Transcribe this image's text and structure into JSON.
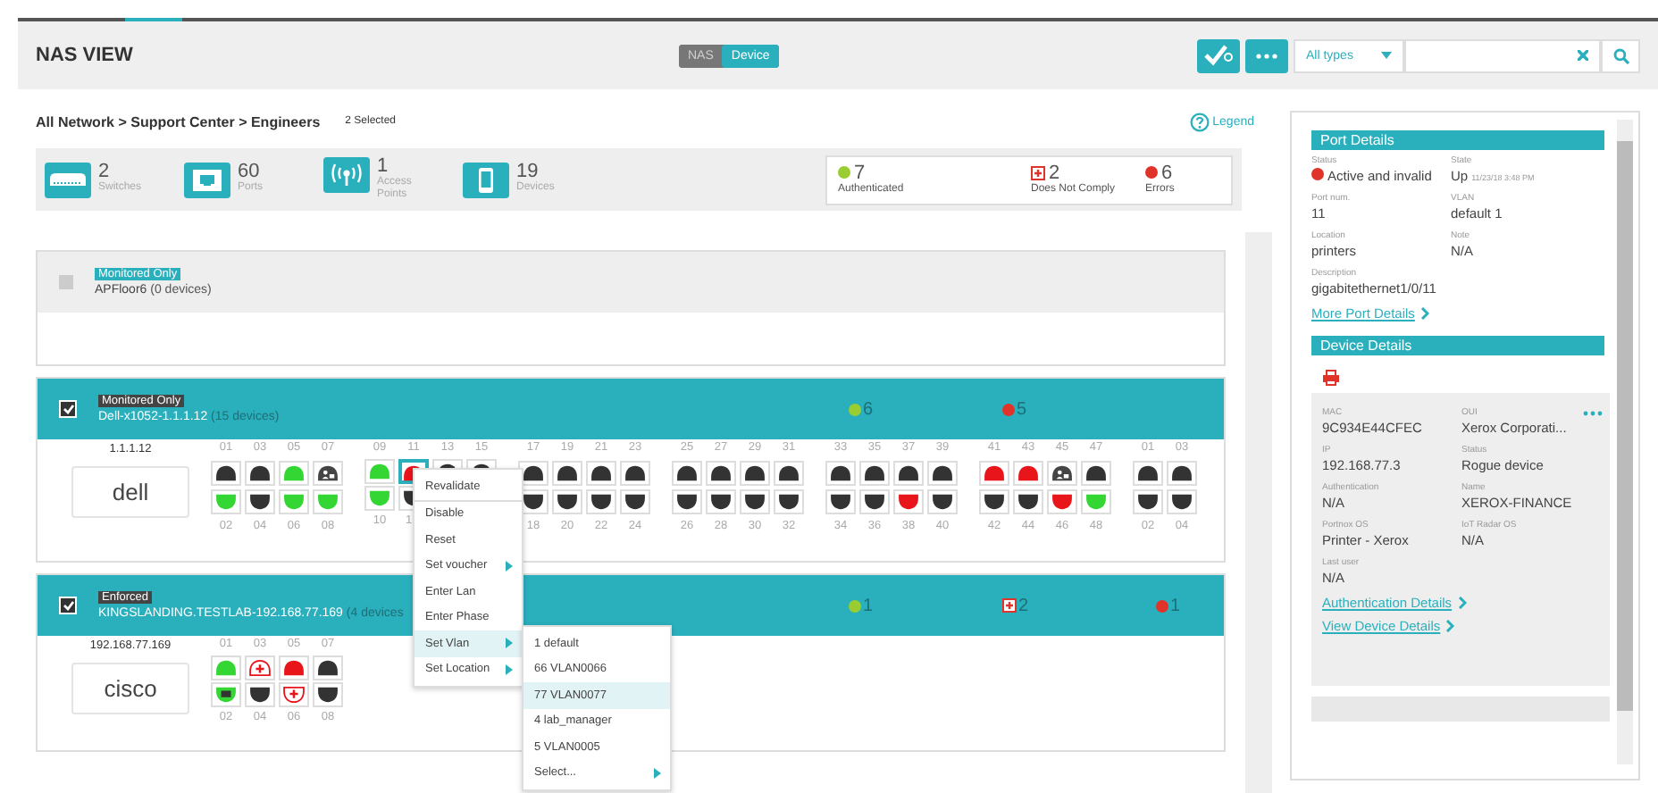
{
  "header": {
    "title": "NAS VIEW",
    "view_toggle": [
      {
        "label": "NAS",
        "selected": false
      },
      {
        "label": "Device",
        "selected": true
      }
    ],
    "type_filter": "All types"
  },
  "breadcrumb": "All Network > Support Center > Engineers",
  "selection_count": "2 Selected",
  "legend": "Legend",
  "stats": [
    {
      "kind": "switch",
      "value": "2",
      "label": "Switches"
    },
    {
      "kind": "port",
      "value": "60",
      "label": "Ports"
    },
    {
      "kind": "wifi",
      "value": "1",
      "label": "Access Points"
    },
    {
      "kind": "phone",
      "value": "19",
      "label": "Devices"
    }
  ],
  "summary": [
    {
      "kind": "authenticated",
      "value": "7",
      "label": "Authenticated"
    },
    {
      "kind": "noncompliant",
      "value": "2",
      "label": "Does Not Comply"
    },
    {
      "kind": "error",
      "value": "6",
      "label": "Errors"
    }
  ],
  "switches": [
    {
      "badge": "Monitored Only",
      "name": "APFloor6",
      "device_count": "(0 devices)",
      "checked": false,
      "selected": false
    },
    {
      "badge": "Monitored Only",
      "name": "Dell-x1052-1.1.1.12",
      "device_count": "(15 devices)",
      "checked": true,
      "selected": true,
      "ip": "1.1.1.12",
      "logo": "dell",
      "counts": [
        {
          "kind": "authenticated",
          "value": "6"
        },
        {
          "kind": "error",
          "value": "5"
        }
      ],
      "port_groups": [
        {
          "top": [
            {
              "number": "01",
              "kind": "black",
              "selected": false
            },
            {
              "number": "03",
              "kind": "black",
              "selected": false
            },
            {
              "number": "05",
              "kind": "green",
              "selected": false
            },
            {
              "number": "07",
              "kind": "user",
              "selected": false
            }
          ],
          "bottom": [
            {
              "number": "02",
              "kind": "green",
              "selected": false
            },
            {
              "number": "04",
              "kind": "black",
              "selected": false
            },
            {
              "number": "06",
              "kind": "green",
              "selected": false
            },
            {
              "number": "08",
              "kind": "green",
              "selected": false
            }
          ]
        },
        {
          "top": [
            {
              "number": "09",
              "kind": "green",
              "selected": false
            },
            {
              "number": "11",
              "kind": "red",
              "selected": true
            },
            {
              "number": "13",
              "kind": "black",
              "selected": false
            },
            {
              "number": "15",
              "kind": "black",
              "selected": false
            }
          ],
          "bottom": [
            {
              "number": "10",
              "kind": "green",
              "selected": false
            },
            {
              "number": "1",
              "kind": "black",
              "selected": false
            }
          ]
        },
        {
          "top": [
            {
              "number": "17",
              "kind": "black",
              "selected": false
            },
            {
              "number": "19",
              "kind": "black",
              "selected": false
            },
            {
              "number": "21",
              "kind": "black",
              "selected": false
            },
            {
              "number": "23",
              "kind": "black",
              "selected": false
            }
          ],
          "bottom": [
            {
              "number": "18",
              "kind": "black",
              "selected": false
            },
            {
              "number": "20",
              "kind": "black",
              "selected": false
            },
            {
              "number": "22",
              "kind": "black",
              "selected": false
            },
            {
              "number": "24",
              "kind": "black",
              "selected": false
            }
          ]
        },
        {
          "top": [
            {
              "number": "25",
              "kind": "black",
              "selected": false
            },
            {
              "number": "27",
              "kind": "black",
              "selected": false
            },
            {
              "number": "29",
              "kind": "black",
              "selected": false
            },
            {
              "number": "31",
              "kind": "black",
              "selected": false
            }
          ],
          "bottom": [
            {
              "number": "26",
              "kind": "black",
              "selected": false
            },
            {
              "number": "28",
              "kind": "black",
              "selected": false
            },
            {
              "number": "30",
              "kind": "black",
              "selected": false
            },
            {
              "number": "32",
              "kind": "black",
              "selected": false
            }
          ]
        },
        {
          "top": [
            {
              "number": "33",
              "kind": "black",
              "selected": false
            },
            {
              "number": "35",
              "kind": "black",
              "selected": false
            },
            {
              "number": "37",
              "kind": "black",
              "selected": false
            },
            {
              "number": "39",
              "kind": "black",
              "selected": false
            }
          ],
          "bottom": [
            {
              "number": "34",
              "kind": "black",
              "selected": false
            },
            {
              "number": "36",
              "kind": "black",
              "selected": false
            },
            {
              "number": "38",
              "kind": "red",
              "selected": false
            },
            {
              "number": "40",
              "kind": "black",
              "selected": false
            }
          ]
        },
        {
          "top": [
            {
              "number": "41",
              "kind": "red",
              "selected": false
            },
            {
              "number": "43",
              "kind": "red",
              "selected": false
            },
            {
              "number": "45",
              "kind": "user",
              "selected": false
            },
            {
              "number": "47",
              "kind": "black",
              "selected": false
            }
          ],
          "bottom": [
            {
              "number": "42",
              "kind": "black",
              "selected": false
            },
            {
              "number": "44",
              "kind": "black",
              "selected": false
            },
            {
              "number": "46",
              "kind": "red",
              "selected": false
            },
            {
              "number": "48",
              "kind": "green",
              "selected": false
            }
          ]
        },
        {
          "top": [
            {
              "number": "01",
              "kind": "black",
              "selected": false
            },
            {
              "number": "03",
              "kind": "black",
              "selected": false
            }
          ],
          "bottom": [
            {
              "number": "02",
              "kind": "black",
              "selected": false
            },
            {
              "number": "04",
              "kind": "black",
              "selected": false
            }
          ]
        }
      ]
    },
    {
      "badge": "Enforced",
      "name": "KINGSLANDING.TESTLAB-192.168.77.169",
      "device_count": "(4 devices",
      "checked": true,
      "selected": true,
      "ip": "192.168.77.169",
      "logo": "cisco",
      "counts": [
        {
          "kind": "authenticated",
          "value": "1"
        },
        {
          "kind": "noncompliant",
          "value": "2"
        },
        {
          "kind": "error",
          "value": "1"
        }
      ],
      "port_groups": [
        {
          "top": [
            {
              "number": "01",
              "kind": "green",
              "selected": false
            },
            {
              "number": "03",
              "kind": "plus",
              "selected": false
            },
            {
              "number": "05",
              "kind": "red",
              "selected": false
            },
            {
              "number": "07",
              "kind": "black",
              "selected": false
            }
          ],
          "bottom": [
            {
              "number": "02",
              "kind": "green-user",
              "selected": false
            },
            {
              "number": "04",
              "kind": "black",
              "selected": false
            },
            {
              "number": "06",
              "kind": "plus",
              "selected": false
            },
            {
              "number": "08",
              "kind": "black",
              "selected": false
            }
          ]
        }
      ]
    }
  ],
  "context_menu": {
    "items": [
      {
        "label": "Revalidate",
        "submenu": false,
        "selected": false
      },
      {
        "label": "Disable",
        "submenu": false,
        "selected": false
      },
      {
        "label": "Reset",
        "submenu": false,
        "selected": false
      },
      {
        "label": "Set voucher",
        "submenu": true,
        "selected": false
      },
      {
        "label": "Enter Lan",
        "submenu": false,
        "selected": false
      },
      {
        "label": "Enter Phase",
        "submenu": false,
        "selected": false
      },
      {
        "label": "Set Vlan",
        "submenu": true,
        "selected": true
      },
      {
        "label": "Set Location",
        "submenu": true,
        "selected": false
      }
    ],
    "submenu": [
      {
        "label": "1 default",
        "submenu": false,
        "selected": false
      },
      {
        "label": "66 VLAN0066",
        "submenu": false,
        "selected": false
      },
      {
        "label": "77 VLAN0077",
        "submenu": false,
        "selected": true
      },
      {
        "label": "4 lab_manager",
        "submenu": false,
        "selected": false
      },
      {
        "label": "5 VLAN0005",
        "submenu": false,
        "selected": false
      },
      {
        "label": "Select...",
        "submenu": true,
        "selected": false
      }
    ]
  },
  "port_details": {
    "title": "Port Details",
    "fields": [
      {
        "kind": "status",
        "label": "Status",
        "value": "Active and invalid"
      },
      {
        "kind": "dated",
        "label": "State",
        "value": "Up",
        "note": "11/23/18 3:48 PM"
      },
      {
        "kind": "text",
        "label": "Port num.",
        "value": "11"
      },
      {
        "kind": "text",
        "label": "VLAN",
        "value": "default 1"
      },
      {
        "kind": "text",
        "label": "Location",
        "value": "printers"
      },
      {
        "kind": "text",
        "label": "Note",
        "value": "N/A"
      },
      {
        "kind": "text",
        "label": "Description",
        "value": "gigabitethernet1/0/11"
      }
    ],
    "link": "More Port Details"
  },
  "device_details": {
    "title": "Device Details",
    "fields": [
      {
        "label": "MAC",
        "value": "9C934E44CFEC"
      },
      {
        "label": "OUI",
        "value": "Xerox Corporati..."
      },
      {
        "label": "IP",
        "value": "192.168.77.3"
      },
      {
        "label": "Status",
        "value": "Rogue device"
      },
      {
        "label": "Authentication",
        "value": "N/A"
      },
      {
        "label": "Name",
        "value": "XEROX-FINANCE"
      },
      {
        "label": "Portnox OS",
        "value": "Printer - Xerox"
      },
      {
        "label": "IoT Radar OS",
        "value": "N/A"
      },
      {
        "label": "Last user",
        "value": "N/A"
      }
    ],
    "links": [
      "Authentication Details",
      "View Device Details"
    ]
  }
}
